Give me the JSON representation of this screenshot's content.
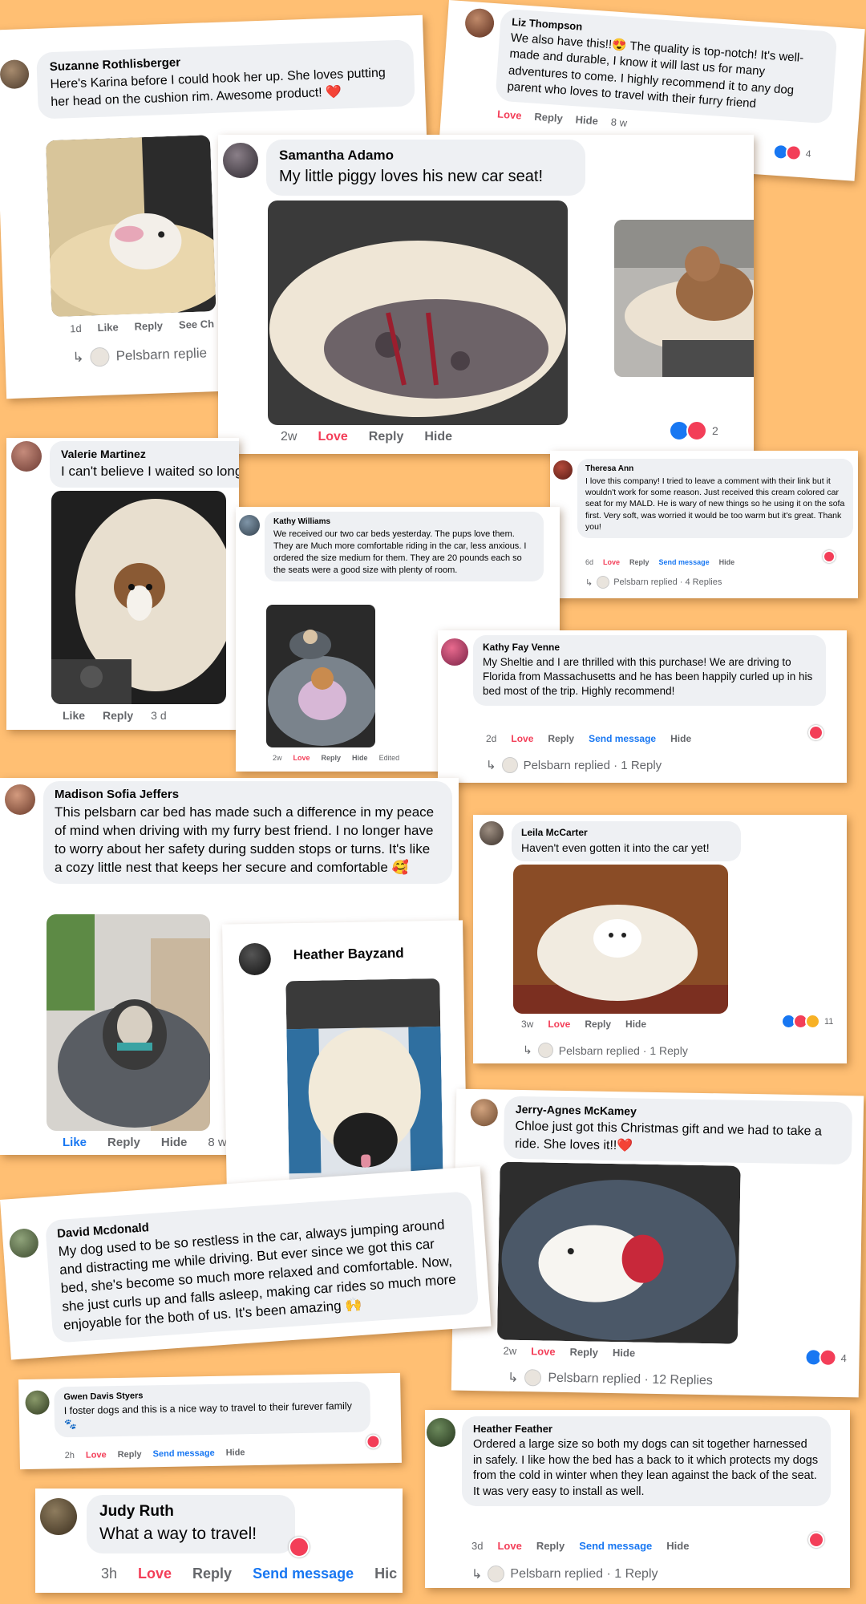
{
  "actions": {
    "like": "Like",
    "reply": "Reply",
    "love": "Love",
    "hide": "Hide",
    "send_message": "Send message",
    "see_ch": "See Ch",
    "edited": "Edited"
  },
  "comments": {
    "suzanne": {
      "name": "Suzanne Rothlisberger",
      "text": "Here's Karina before I could hook her up. She loves putting her head on the cushion rim. Awesome product! ❤️",
      "time": "1d",
      "replied": "Pelsbarn replie"
    },
    "liz": {
      "name": "Liz Thompson",
      "text": "We also have this!!😍 The quality is top-notch! It's well-made and durable, I know it will last us for many adventures to come. I highly recommend it to any dog parent who loves to travel with their furry friend",
      "time": "8 w",
      "reactions": "4"
    },
    "samantha": {
      "name": "Samantha Adamo",
      "text": "My little piggy loves his new car seat!",
      "time": "2w",
      "reactions": "2"
    },
    "valerie": {
      "name": "Valerie Martinez",
      "text": "I can't believe I waited so long.. we love ours 🙏",
      "time": "3 d"
    },
    "theresa": {
      "name": "Theresa Ann",
      "text": "I love this company! I tried to leave a comment with their link but it wouldn't work for some reason. Just received this cream colored car seat for my MALD. He is wary of new things so he using it on the sofa first. Very soft, was worried it would be too warm but it's great. Thank you!",
      "time": "6d",
      "replied": "Pelsbarn replied · 4 Replies"
    },
    "kathy_w": {
      "name": "Kathy Williams",
      "text": "We received our two car beds yesterday. The pups love them. They are Much more comfortable riding in the car, less anxious. I ordered the size medium for them. They are 20 pounds each so the seats were a good size with plenty of room.",
      "time": "2w"
    },
    "kathy_f": {
      "name": "Kathy Fay Venne",
      "text": "My Sheltie and I are thrilled with this purchase! We are driving to Florida from Massachusetts and he has been happily curled up in his bed most of the trip. Highly recommend!",
      "time": "2d",
      "replied": "Pelsbarn replied · 1 Reply"
    },
    "madison": {
      "name": "Madison Sofia Jeffers",
      "text": "This pelsbarn car bed has made such a difference in my peace of mind when driving with my furry best friend. I no longer have to worry about her safety during sudden stops or turns. It's like a cozy little nest that keeps her secure and comfortable 🥰",
      "time": "8 w"
    },
    "leila": {
      "name": "Leila McCarter",
      "text": "Haven't even gotten it into the car yet!",
      "time": "3w",
      "replied": "Pelsbarn replied · 1 Reply",
      "reactions": "11"
    },
    "heather_b": {
      "name": "Heather Bayzand"
    },
    "jerry": {
      "name": "Jerry-Agnes McKamey",
      "text": "Chloe just got this Christmas gift and we had to take a ride. She loves it!!❤️",
      "time": "2w",
      "replied": "Pelsbarn replied · 12 Replies",
      "reactions": "4"
    },
    "david": {
      "name": "David Mcdonald",
      "text": "My dog used to be so restless in the car, always jumping around and distracting me while driving. But ever since we got this car bed, she's become so much more relaxed and comfortable. Now, she just curls up and falls asleep, making car rides so much more enjoyable for the both of us. It's been amazing 🙌"
    },
    "gwen": {
      "name": "Gwen Davis Styers",
      "text": "I foster dogs and this is a nice way to travel to their furever family 🐾",
      "time": "2h"
    },
    "judy": {
      "name": "Judy Ruth",
      "text": "What a way to travel!",
      "time": "3h",
      "hide_partial": "Hic"
    },
    "heather_f": {
      "name": "Heather Feather",
      "text": "Ordered a large size so both my dogs can sit together harnessed in safely. I like how the bed has a back to it which protects my dogs from the cold in winter when they lean against the back of the seat. It was very easy to install as well.",
      "time": "3d",
      "replied": "Pelsbarn replied · 1 Reply"
    }
  },
  "colors": {
    "background": "#ffbf73",
    "bubble": "#eef0f3",
    "love": "#f33e58",
    "facebook_blue": "#1877f2",
    "meta_grey": "#65676b"
  }
}
